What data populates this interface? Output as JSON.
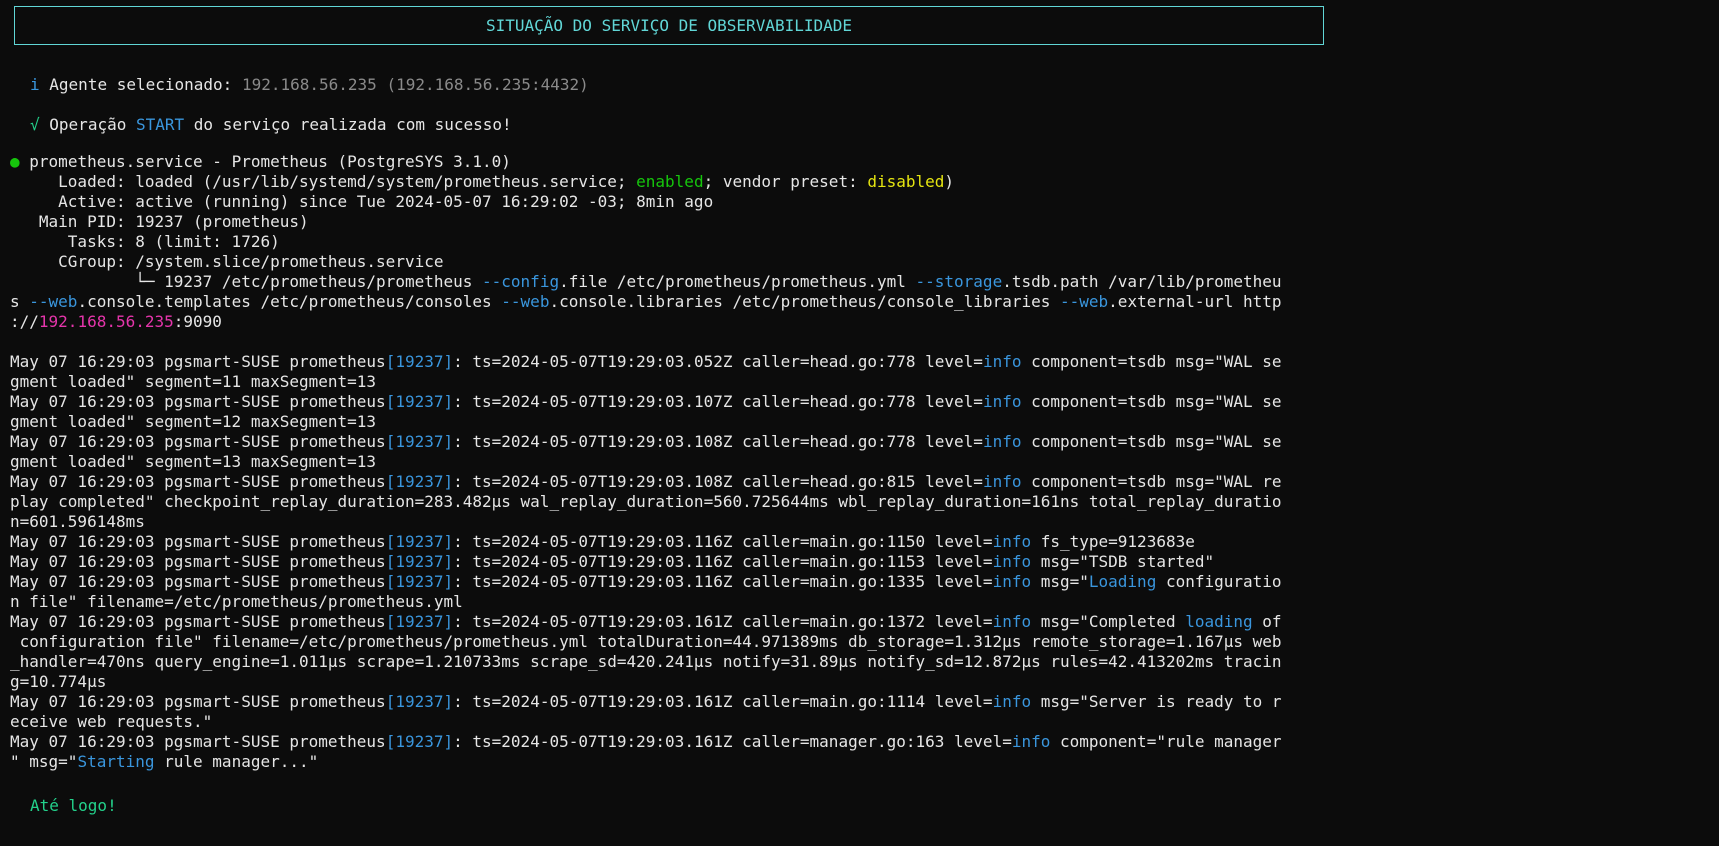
{
  "banner": {
    "title": "SITUAÇÃO DO SERVIÇO DE OBSERVABILIDADE"
  },
  "info": {
    "icon": "i",
    "label": "Agente selecionado:",
    "value": "192.168.56.235 (192.168.56.235:4432)"
  },
  "success": {
    "icon": "√",
    "prefix": "Operação",
    "op": "START",
    "suffix": "do serviço realizada com sucesso!"
  },
  "status": {
    "dot": "●",
    "header": "prometheus.service - Prometheus (PostgreSYS 3.1.0)",
    "loaded_pre": "     Loaded: loaded (/usr/lib/systemd/system/prometheus.service; ",
    "loaded_enabled": "enabled",
    "loaded_mid": "; vendor preset: ",
    "loaded_disabled": "disabled",
    "loaded_post": ")",
    "active": "     Active: active (running) since Tue 2024-05-07 16:29:02 -03; 8min ago",
    "mainpid": "   Main PID: 19237 (prometheus)",
    "tasks": "      Tasks: 8 (limit: 1726)",
    "cgroup": "     CGroup: /system.slice/prometheus.service",
    "cmd1_a": "             └─ 19237 /etc/prometheus/prometheus ",
    "cmd1_b": "--config",
    "cmd1_c": ".file /etc/prometheus/prometheus.yml ",
    "cmd1_d": "--storage",
    "cmd1_e": ".tsdb.path /var/lib/promethеu",
    "cmd2_a": "s ",
    "cmd2_b": "--web",
    "cmd2_c": ".console.templates /etc/prometheus/consoles ",
    "cmd2_d": "--web",
    "cmd2_e": ".console.libraries /etc/prometheus/console_libraries ",
    "cmd2_f": "--web",
    "cmd2_g": ".external-url http",
    "cmd3_a": "://",
    "cmd3_b": "192.168.56.235",
    "cmd3_c": ":9090"
  },
  "logs": {
    "prefix": "May 07 16:29:03 pgsmart-SUSE prometheus",
    "pid": "[19237]",
    "l1a": ": ts=2024-05-07T19:29:03.052Z caller=head.go:778 level=",
    "l1b": " component=tsdb msg=\"WAL se",
    "l1c": "gment loaded\" segment=11 maxSegment=13",
    "l2a": ": ts=2024-05-07T19:29:03.107Z caller=head.go:778 level=",
    "l2b": " component=tsdb msg=\"WAL se",
    "l2c": "gment loaded\" segment=12 maxSegment=13",
    "l3a": ": ts=2024-05-07T19:29:03.108Z caller=head.go:778 level=",
    "l3b": " component=tsdb msg=\"WAL se",
    "l3c": "gment loaded\" segment=13 maxSegment=13",
    "l4a": ": ts=2024-05-07T19:29:03.108Z caller=head.go:815 level=",
    "l4b": " component=tsdb msg=\"WAL re",
    "l4c": "play completed\" checkpoint_replay_duration=283.482µs wal_replay_duration=560.725644ms wbl_replay_duration=161ns total_replay_duratio",
    "l4d": "n=601.596148ms",
    "l5a": ": ts=2024-05-07T19:29:03.116Z caller=main.go:1150 level=",
    "l5b": " fs_type=9123683e",
    "l6a": ": ts=2024-05-07T19:29:03.116Z caller=main.go:1153 level=",
    "l6b": " msg=\"TSDB started\"",
    "l7a": ": ts=2024-05-07T19:29:03.116Z caller=main.go:1335 level=",
    "l7b": " msg=\"",
    "l7loading": "Loading",
    "l7c": " configuratio",
    "l7d": "n file\" filename=/etc/prometheus/prometheus.yml",
    "l8a": ": ts=2024-05-07T19:29:03.161Z caller=main.go:1372 level=",
    "l8b": " msg=\"Completed ",
    "l8loading": "loading",
    "l8c": " of",
    "l8d": " configuration file\" filename=/etc/prometheus/prometheus.yml totalDuration=44.971389ms db_storage=1.312µs remote_storage=1.167µs web",
    "l8e": "_handler=470ns query_engine=1.011µs scrape=1.210733ms scrape_sd=420.241µs notify=31.89µs notify_sd=12.872µs rules=42.413202ms tracin",
    "l8f": "g=10.774µs",
    "l9a": ": ts=2024-05-07T19:29:03.161Z caller=main.go:1114 level=",
    "l9b": " msg=\"Server is ready to r",
    "l9c": "eceive web requests.\"",
    "l10a": ": ts=2024-05-07T19:29:03.161Z caller=manager.go:163 level=",
    "l10b": " component=\"rule manager",
    "l10c": "\" msg=\"",
    "l10starting": "Starting",
    "l10d": " rule manager...\"",
    "level": "info"
  },
  "goodbye": "Até logo!",
  "colors": {
    "background": "#0c0c0c",
    "foreground": "#cccccc",
    "cyan": "#3a96dd",
    "green": "#16c60c",
    "yellow": "#e5e510",
    "magenta": "#e535ab"
  }
}
